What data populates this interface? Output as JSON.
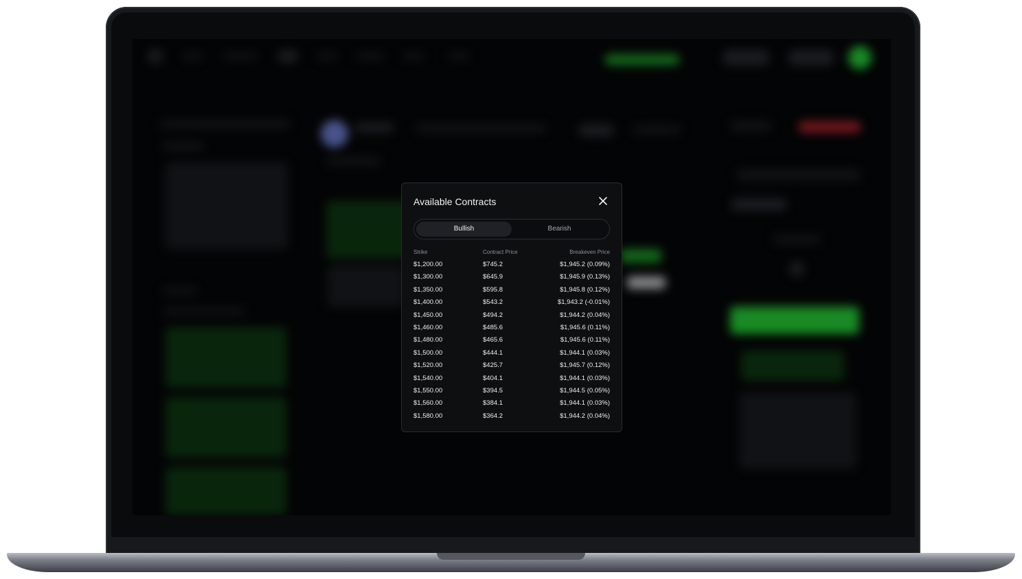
{
  "modal": {
    "title": "Available Contracts",
    "tabs": [
      {
        "label": "Bullish",
        "active": true
      },
      {
        "label": "Bearish",
        "active": false
      }
    ],
    "columns": [
      "Strike",
      "Contract Price",
      "Breakeven Price"
    ],
    "rows": [
      {
        "strike": "$1,200.00",
        "price": "$745.2",
        "breakeven": "$1,945.2 (0.09%)"
      },
      {
        "strike": "$1,300.00",
        "price": "$645.9",
        "breakeven": "$1,945.9 (0.13%)"
      },
      {
        "strike": "$1,350.00",
        "price": "$595.8",
        "breakeven": "$1,945.8 (0.12%)"
      },
      {
        "strike": "$1,400.00",
        "price": "$543.2",
        "breakeven": "$1,943.2 (-0.01%)"
      },
      {
        "strike": "$1,450.00",
        "price": "$494.2",
        "breakeven": "$1,944.2 (0.04%)"
      },
      {
        "strike": "$1,460.00",
        "price": "$485.6",
        "breakeven": "$1,945.6 (0.11%)"
      },
      {
        "strike": "$1,480.00",
        "price": "$465.6",
        "breakeven": "$1,945.6 (0.11%)"
      },
      {
        "strike": "$1,500.00",
        "price": "$444.1",
        "breakeven": "$1,944.1 (0.03%)"
      },
      {
        "strike": "$1,520.00",
        "price": "$425.7",
        "breakeven": "$1,945.7 (0.12%)"
      },
      {
        "strike": "$1,540.00",
        "price": "$404.1",
        "breakeven": "$1,944.1 (0.03%)"
      },
      {
        "strike": "$1,550.00",
        "price": "$394.5",
        "breakeven": "$1,944.5 (0.05%)"
      },
      {
        "strike": "$1,560.00",
        "price": "$384.1",
        "breakeven": "$1,944.1 (0.03%)"
      },
      {
        "strike": "$1,580.00",
        "price": "$364.2",
        "breakeven": "$1,944.2 (0.04%)"
      }
    ]
  },
  "icons": {
    "close": "close-icon"
  },
  "colors": {
    "accent_green": "#27d33a",
    "accent_red": "#b3262e",
    "modal_bg": "#0e0f11"
  }
}
